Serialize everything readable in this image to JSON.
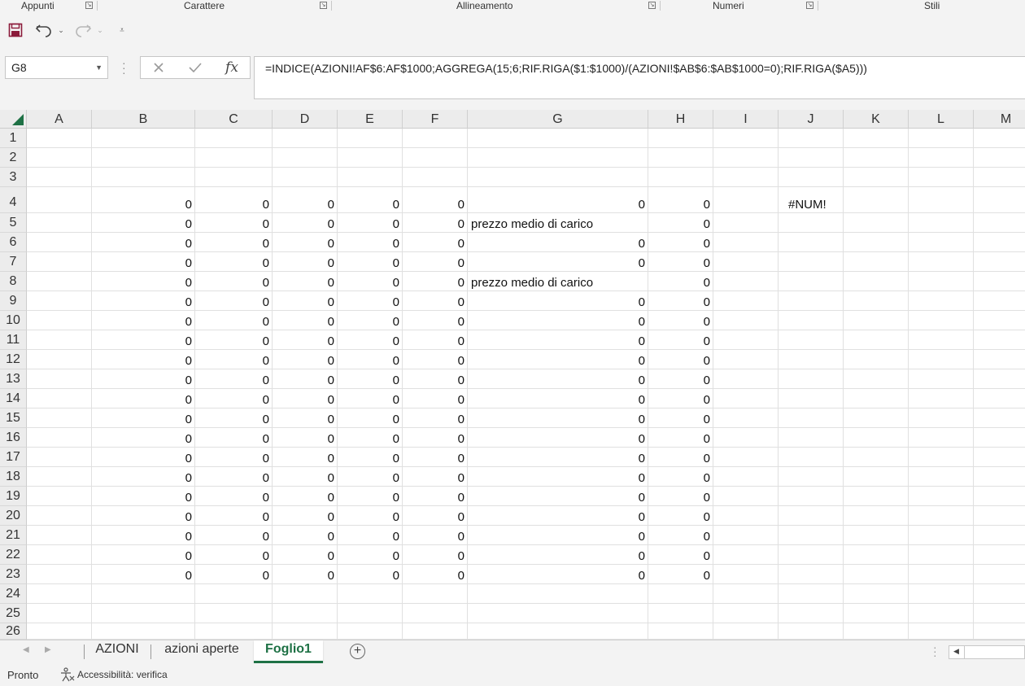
{
  "ribbon": {
    "groups": [
      "Appunti",
      "Carattere",
      "Allineamento",
      "Numeri",
      "Stili"
    ]
  },
  "qat": {
    "save_icon": "save-icon",
    "undo_icon": "undo-icon",
    "redo_icon": "redo-icon",
    "customize_icon": "customize-qat-icon"
  },
  "formula_bar": {
    "name_box": "G8",
    "cancel_icon": "x-icon",
    "enter_icon": "check-icon",
    "fx_label": "fx",
    "formula": "=INDICE(AZIONI!AF$6:AF$1000;AGGREGA(15;6;RIF.RIGA($1:$1000)/(AZIONI!$AB$6:$AB$1000=0);RIF.RIGA($A5)))"
  },
  "columns": [
    "A",
    "B",
    "C",
    "D",
    "E",
    "F",
    "G",
    "H",
    "I",
    "J",
    "K",
    "L",
    "M"
  ],
  "rows": [
    "1",
    "2",
    "3",
    "4",
    "5",
    "6",
    "7",
    "8",
    "9",
    "10",
    "11",
    "12",
    "13",
    "14",
    "15",
    "16",
    "17",
    "18",
    "19",
    "20",
    "21",
    "22",
    "23",
    "24",
    "25",
    "26"
  ],
  "cells": {
    "zero": "0",
    "g_label": "prezzo medio  di carico",
    "j4": "#NUM!"
  },
  "sheet_tabs": [
    {
      "label": "AZIONI",
      "active": false
    },
    {
      "label": "azioni aperte",
      "active": false
    },
    {
      "label": "Foglio1",
      "active": true
    }
  ],
  "status": {
    "ready": "Pronto",
    "accessibility": "Accessibilità: verifica"
  },
  "colors": {
    "accent": "#1e7145",
    "save_icon": "#8b1a3a"
  }
}
